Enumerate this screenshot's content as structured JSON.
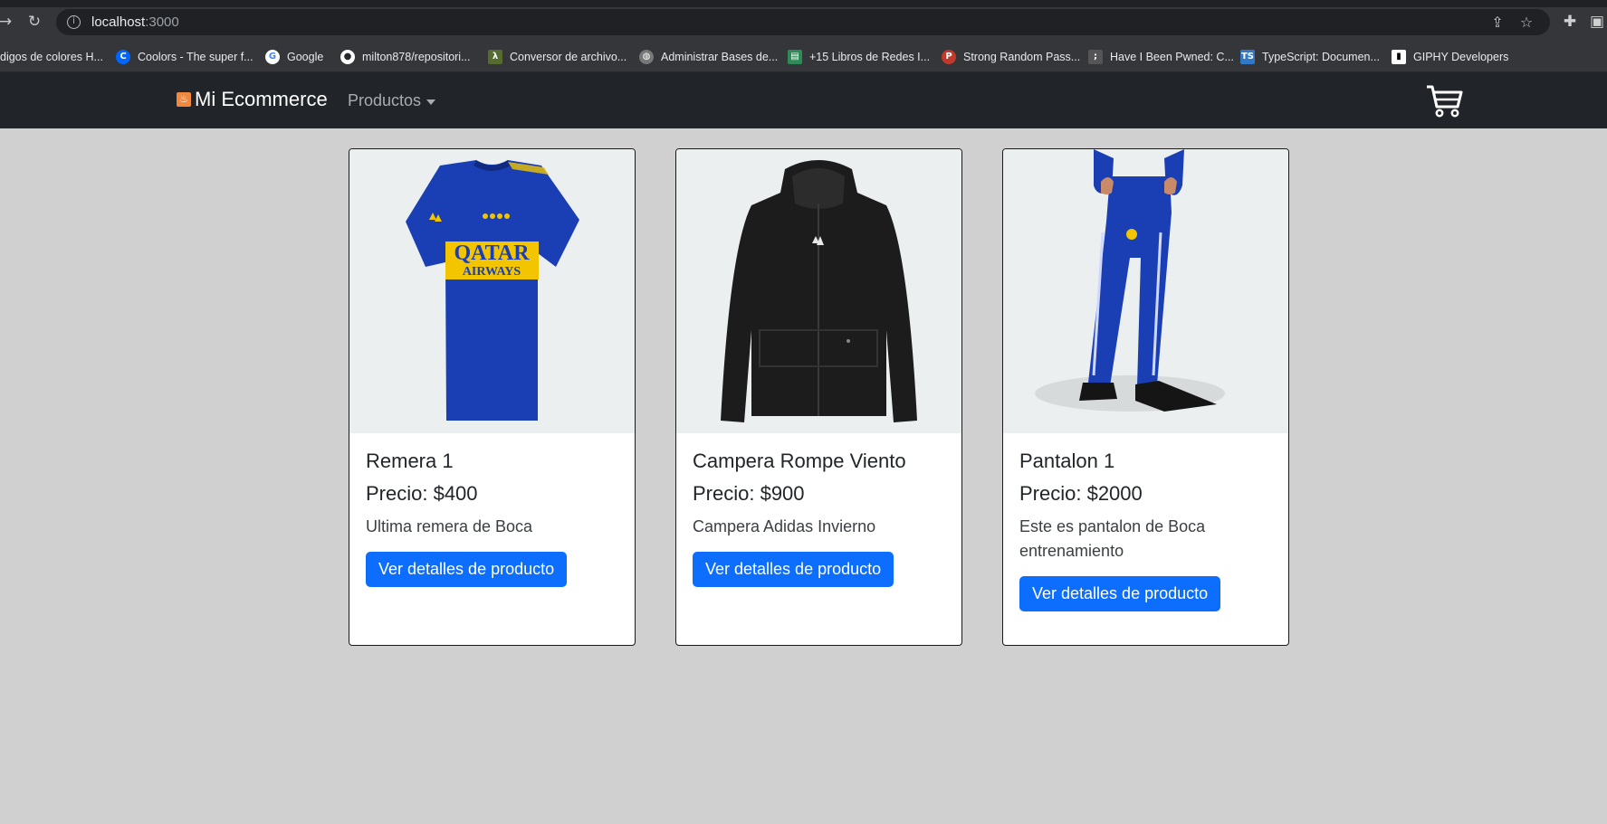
{
  "browser": {
    "url_host": "localhost",
    "url_port": ":3000",
    "bookmarks": [
      {
        "label": "digos de colores H...",
        "icon": "color-codes-icon",
        "color": "#35363a"
      },
      {
        "label": "Coolors - The super f...",
        "icon": "coolors-icon",
        "color": "#0066ff"
      },
      {
        "label": "Google",
        "icon": "google-icon",
        "color": "#ffffff"
      },
      {
        "label": "milton878/repositori...",
        "icon": "github-icon",
        "color": "#ffffff"
      },
      {
        "label": "Conversor de archivo...",
        "icon": "converter-icon",
        "color": "#556b2f"
      },
      {
        "label": "Administrar Bases de...",
        "icon": "globe-icon",
        "color": "#777777"
      },
      {
        "label": "+15 Libros de Redes I...",
        "icon": "book-icon",
        "color": "#2e8b57"
      },
      {
        "label": "Strong Random Pass...",
        "icon": "password-icon",
        "color": "#c0392b"
      },
      {
        "label": "Have I Been Pwned: C...",
        "icon": "pwned-icon",
        "color": "#555555"
      },
      {
        "label": "TypeScript: Documen...",
        "icon": "typescript-icon",
        "color": "#3178c6"
      },
      {
        "label": "GIPHY Developers",
        "icon": "giphy-icon",
        "color": "#ffffff"
      }
    ]
  },
  "navbar": {
    "brand": "Mi Ecommerce",
    "dropdown_label": "Productos"
  },
  "products": [
    {
      "title": "Remera 1",
      "price": "Precio: $400",
      "description": "Ultima remera de Boca",
      "button": "Ver detalles de producto",
      "image": "jersey"
    },
    {
      "title": "Campera Rompe Viento",
      "price": "Precio: $900",
      "description": "Campera Adidas Invierno",
      "button": "Ver detalles de producto",
      "image": "jacket"
    },
    {
      "title": "Pantalon 1",
      "price": "Precio: $2000",
      "description": "Este es pantalon de Boca entrenamiento",
      "button": "Ver detalles de producto",
      "image": "pants"
    }
  ],
  "colors": {
    "page_bg": "#d0d0d0",
    "navbar_bg": "#212529",
    "button_bg": "#0d6efd",
    "boca_blue": "#1a3fb5",
    "boca_gold": "#f2c500"
  }
}
